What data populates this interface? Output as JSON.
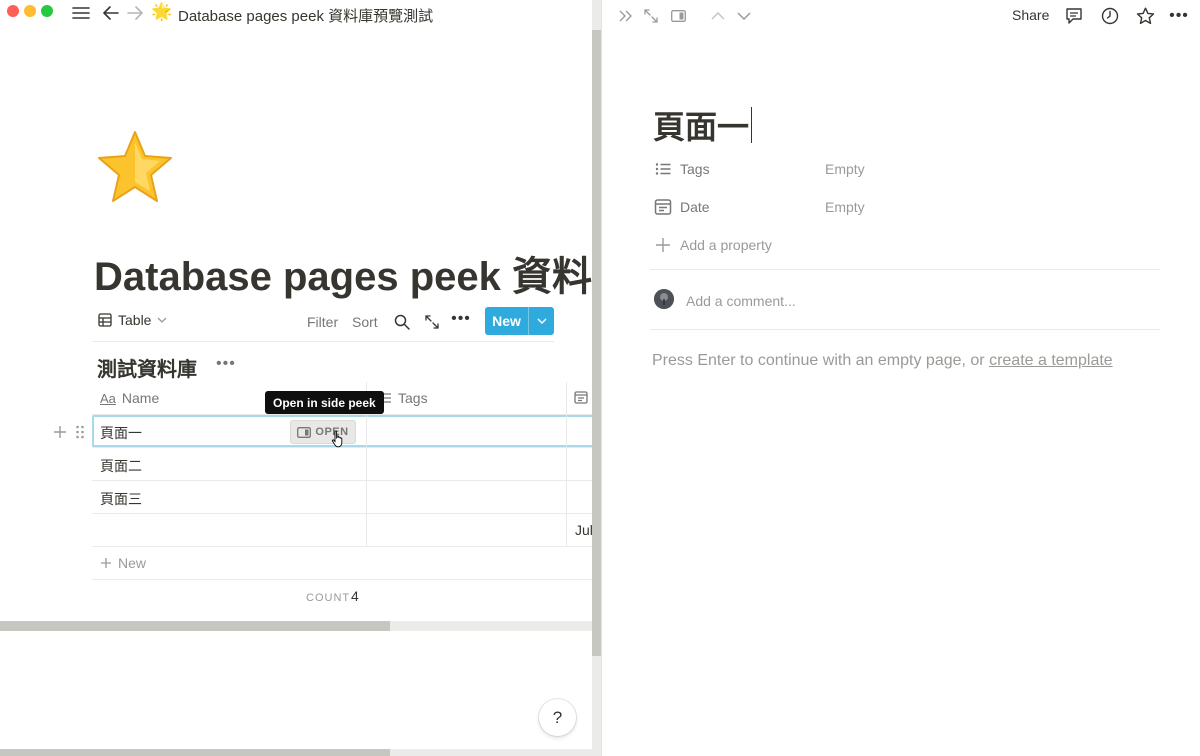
{
  "window": {
    "breadcrumb_emoji": "🌟",
    "breadcrumb_title": "Database pages peek 資料庫預覽測試"
  },
  "page": {
    "title": "Database pages peek 資料庫預覽測試"
  },
  "view": {
    "name": "Table",
    "filter": "Filter",
    "sort": "Sort",
    "new_label": "New"
  },
  "database": {
    "title": "測試資料庫",
    "columns": [
      "Name",
      "Tags"
    ],
    "rows": [
      {
        "name": "頁面一",
        "date": ""
      },
      {
        "name": "頁面二",
        "date": ""
      },
      {
        "name": "頁面三",
        "date": ""
      },
      {
        "name": "",
        "date": "Jul"
      }
    ],
    "new_row_label": "New",
    "count_label": "COUNT",
    "count_value": "4",
    "open_label": "OPEN",
    "tooltip": "Open in side peek"
  },
  "help": {
    "label": "?"
  },
  "peek": {
    "share": "Share",
    "title": "頁面一",
    "properties": [
      {
        "label": "Tags",
        "value": "Empty",
        "icon": "list-icon"
      },
      {
        "label": "Date",
        "value": "Empty",
        "icon": "calendar-icon"
      }
    ],
    "add_property": "Add a property",
    "comment_placeholder": "Add a comment...",
    "empty_hint_prefix": "Press Enter to continue with an empty page, or ",
    "empty_hint_link": "create a template"
  },
  "colors": {
    "accent_blue": "#2eaadc",
    "text": "#37352f",
    "muted": "#9b9a97"
  }
}
